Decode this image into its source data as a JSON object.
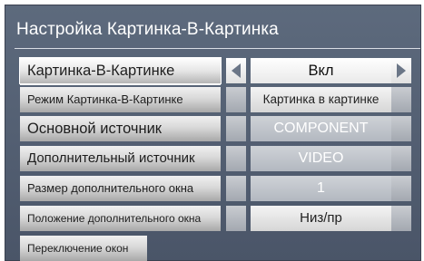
{
  "title": "Настройка Картинка-В-Картинка",
  "rows": [
    {
      "label": "Картинка-В-Картинке",
      "value": "Вкл"
    },
    {
      "label": "Режим Картинка-В-Картинке",
      "value": "Картинка в картинке"
    },
    {
      "label": "Основной источник",
      "value": "COMPONENT"
    },
    {
      "label": "Дополнительный источник",
      "value": "VIDEO"
    },
    {
      "label": "Размер дополнительного окна",
      "value": "1"
    },
    {
      "label": "Положение дополнительного окна",
      "value": "Низ/пр"
    },
    {
      "label": "Переключение окон"
    }
  ],
  "icons": {
    "left": "triangle-left-icon",
    "right": "triangle-right-icon"
  },
  "colors": {
    "panel": "#4f5a6c",
    "highlight": "#ffffff"
  }
}
